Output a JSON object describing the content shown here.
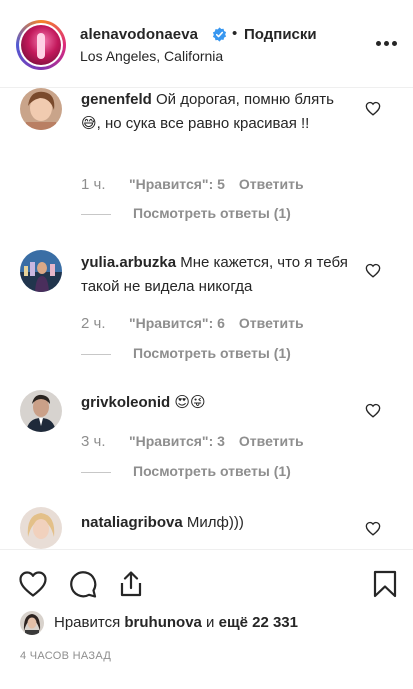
{
  "header": {
    "username": "alenavodonaeva",
    "separator": "•",
    "follow_label": "Подписки",
    "location": "Los Angeles, California",
    "verified_icon": "verified-badge-icon",
    "more_icon": "more-options-icon"
  },
  "comments": [
    {
      "username": "genenfeld",
      "text": "Ой дорогая, помню блять 😅, но сука все равно красивая !!",
      "time": "1 ч.",
      "likes": "\"Нравится\": 5",
      "reply": "Ответить",
      "view_replies": "Посмотреть ответы (1)"
    },
    {
      "username": "yulia.arbuzka",
      "text": "Мне кажется, что я тебя такой не видела никогда",
      "time": "2 ч.",
      "likes": "\"Нравится\": 6",
      "reply": "Ответить",
      "view_replies": "Посмотреть ответы (1)"
    },
    {
      "username": "grivkoleonid",
      "text": "😍😜",
      "time": "3 ч.",
      "likes": "\"Нравится\": 3",
      "reply": "Ответить",
      "view_replies": "Посмотреть ответы (1)"
    },
    {
      "username": "nataliagribova",
      "text": "Милф)))"
    }
  ],
  "actions": {
    "like_icon": "heart-icon",
    "comment_icon": "comment-icon",
    "share_icon": "share-icon",
    "save_icon": "bookmark-icon"
  },
  "likes": {
    "prefix": "Нравится",
    "user": "bruhunova",
    "middle": "и",
    "count": "ещё 22 331"
  },
  "timestamp": "4 ЧАСОВ НАЗАД",
  "colors": {
    "text": "#262626",
    "secondary": "#8e8e8e",
    "verified": "#3897f0"
  }
}
